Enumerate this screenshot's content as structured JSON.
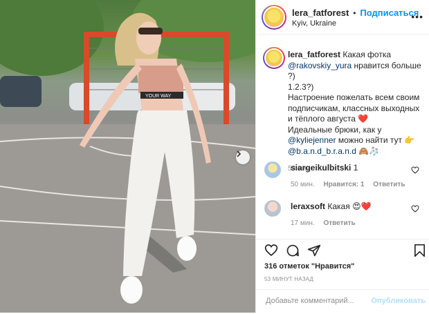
{
  "post": {
    "author": "lera_fatforest",
    "follow_label": "Подписаться",
    "separator": "•",
    "location": "Kyiv, Ukraine",
    "more_icon": "more-dots-icon",
    "photo_next_icon": "chevron-right-icon"
  },
  "caption": {
    "author": "lera_fatforest",
    "line1": "Какая фотка",
    "mention1": "@rakovskiy_yura",
    "line1b": " нравится больше ?)",
    "line2": "1.2.3?)",
    "line3": "Настроение пожелать всем своим подписчикам, классных выходных и тёплого августа",
    "heart": "❤️",
    "line4": "Идеальные брюки, как у",
    "mention2": "@kyliejenner",
    "line4b": " можно найти тут ",
    "pointing": "👉",
    "mention3": "@b.a.n.d_b.r.a.n.d",
    "emoji_end": "🙈🧦",
    "time": "53 мин."
  },
  "comments": [
    {
      "user": "siargeikulbitski",
      "text": "1",
      "time": "50 мин.",
      "likes": "Нравится: 1",
      "reply": "Ответить"
    },
    {
      "user": "leraxsoft",
      "text": "Какая",
      "emoji": "😍❤️",
      "time": "17 мин.",
      "reply": "Ответить"
    }
  ],
  "actions": {
    "likes_text": "316 отметок \"Нравится\"",
    "date": "53 МИНУТ НАЗАД",
    "comment_placeholder": "Добавьте комментарий...",
    "publish_label": "Опубликовать"
  },
  "colors": {
    "accent": "#0095f6",
    "publish_disabled": "#b2dffc",
    "muted": "#8e8e8e",
    "mention": "#00376b"
  }
}
